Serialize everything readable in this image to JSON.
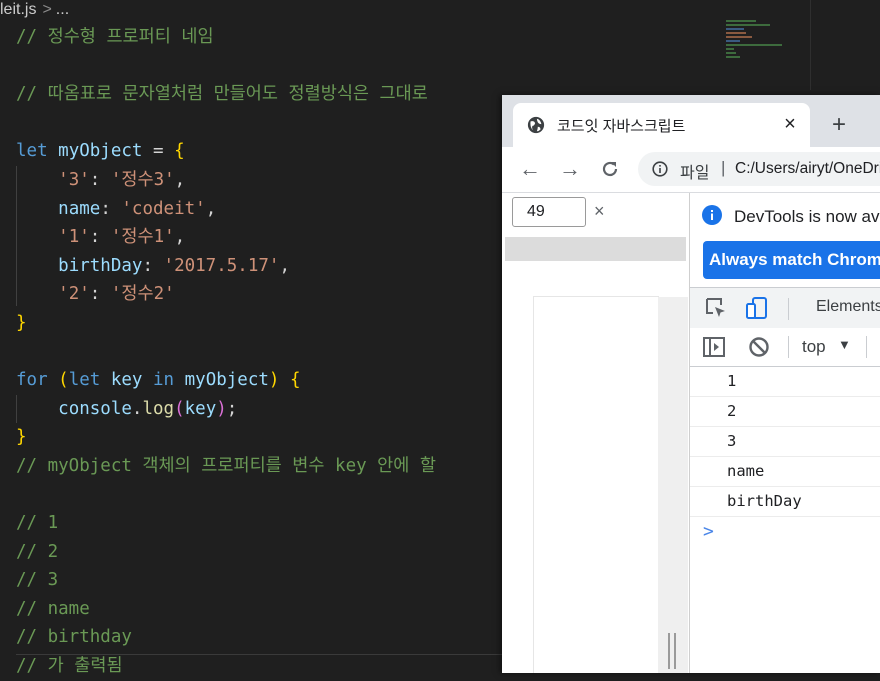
{
  "editor": {
    "breadcrumb": {
      "file": "leit.js",
      "sep": ">",
      "rest": "..."
    },
    "lines": [
      [
        {
          "t": "cm",
          "v": "// 정수형 프로퍼티 네임"
        }
      ],
      [],
      [
        {
          "t": "cm",
          "v": "// 따옴표로 문자열처럼 만들어도 정렬방식은 그대로"
        }
      ],
      [],
      [
        {
          "t": "kw",
          "v": "let "
        },
        {
          "t": "vr",
          "v": "myObject"
        },
        {
          "t": "pl",
          "v": " = "
        },
        {
          "t": "br1",
          "v": "{"
        }
      ],
      [
        {
          "t": "pl",
          "v": "    "
        },
        {
          "t": "st",
          "v": "'3'"
        },
        {
          "t": "pl",
          "v": ": "
        },
        {
          "t": "st",
          "v": "'정수3'"
        },
        {
          "t": "pl",
          "v": ","
        }
      ],
      [
        {
          "t": "pl",
          "v": "    "
        },
        {
          "t": "vr",
          "v": "name"
        },
        {
          "t": "pl",
          "v": ": "
        },
        {
          "t": "st",
          "v": "'codeit'"
        },
        {
          "t": "pl",
          "v": ","
        }
      ],
      [
        {
          "t": "pl",
          "v": "    "
        },
        {
          "t": "st",
          "v": "'1'"
        },
        {
          "t": "pl",
          "v": ": "
        },
        {
          "t": "st",
          "v": "'정수1'"
        },
        {
          "t": "pl",
          "v": ","
        }
      ],
      [
        {
          "t": "pl",
          "v": "    "
        },
        {
          "t": "vr",
          "v": "birthDay"
        },
        {
          "t": "pl",
          "v": ": "
        },
        {
          "t": "st",
          "v": "'2017.5.17'"
        },
        {
          "t": "pl",
          "v": ","
        }
      ],
      [
        {
          "t": "pl",
          "v": "    "
        },
        {
          "t": "st",
          "v": "'2'"
        },
        {
          "t": "pl",
          "v": ": "
        },
        {
          "t": "st",
          "v": "'정수2'"
        }
      ],
      [
        {
          "t": "br1",
          "v": "}"
        }
      ],
      [],
      [
        {
          "t": "kw",
          "v": "for "
        },
        {
          "t": "br1",
          "v": "("
        },
        {
          "t": "kw",
          "v": "let "
        },
        {
          "t": "vr",
          "v": "key"
        },
        {
          "t": "kw",
          "v": " in "
        },
        {
          "t": "vr",
          "v": "myObject"
        },
        {
          "t": "br1",
          "v": ")"
        },
        {
          "t": "pl",
          "v": " "
        },
        {
          "t": "br1",
          "v": "{"
        }
      ],
      [
        {
          "t": "pl",
          "v": "    "
        },
        {
          "t": "vr",
          "v": "console"
        },
        {
          "t": "pl",
          "v": "."
        },
        {
          "t": "fn",
          "v": "log"
        },
        {
          "t": "br2",
          "v": "("
        },
        {
          "t": "vr",
          "v": "key"
        },
        {
          "t": "br2",
          "v": ")"
        },
        {
          "t": "pl",
          "v": ";"
        }
      ],
      [
        {
          "t": "br1",
          "v": "}"
        }
      ],
      [
        {
          "t": "cm",
          "v": "// myObject 객체의 프로퍼티를 변수 key 안에 할"
        }
      ],
      [],
      [
        {
          "t": "cm",
          "v": "// 1"
        }
      ],
      [
        {
          "t": "cm",
          "v": "// 2"
        }
      ],
      [
        {
          "t": "cm",
          "v": "// 3"
        }
      ],
      [
        {
          "t": "cm",
          "v": "// name"
        }
      ],
      [
        {
          "t": "cm",
          "v": "// birthday"
        }
      ],
      [
        {
          "t": "cm",
          "v": "// 가 출력됨"
        }
      ]
    ]
  },
  "browser": {
    "tab_title": "코드잇 자바스크립트",
    "tab_close": "×",
    "new_tab": "+",
    "nav": {
      "back": "←",
      "forward": "→",
      "reload": "C"
    },
    "omnibox": {
      "protocol": "파일",
      "divider": "|",
      "url": "C:/Users/airyt/OneDrive"
    },
    "viewport": {
      "width_value": "49",
      "close": "×"
    },
    "devtools": {
      "info_message": "DevTools is now available in Korean",
      "info_button": "Always match Chrome's language",
      "tab_label": "Elements",
      "context": "top",
      "context_caret": "▼",
      "logs": [
        "1",
        "2",
        "3",
        "name",
        "birthDay"
      ],
      "prompt": ">"
    }
  },
  "colors": {
    "editor_bg": "#1f1f1f",
    "comment": "#6a9955",
    "keyword": "#569cd6",
    "string": "#ce9178",
    "variable": "#9cdcfe",
    "accent_blue": "#1a73e8"
  }
}
